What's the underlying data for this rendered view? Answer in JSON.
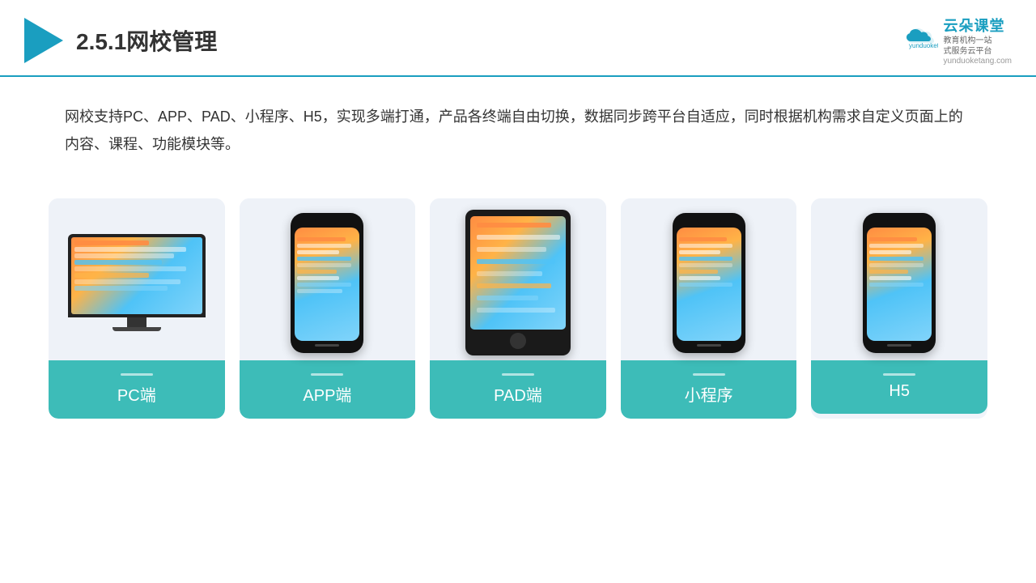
{
  "header": {
    "title": "2.5.1网校管理",
    "brand": {
      "name": "云朵课堂",
      "url": "yunduoketang.com",
      "slogan_line1": "教育机构一站",
      "slogan_line2": "式服务云平台"
    }
  },
  "description": {
    "text": "网校支持PC、APP、PAD、小程序、H5，实现多端打通，产品各终端自由切换，数据同步跨平台自适应，同时根据机构需求自定义页面上的内容、课程、功能模块等。"
  },
  "cards": [
    {
      "id": "pc",
      "label": "PC端",
      "type": "pc"
    },
    {
      "id": "app",
      "label": "APP端",
      "type": "phone"
    },
    {
      "id": "pad",
      "label": "PAD端",
      "type": "tablet"
    },
    {
      "id": "miniprogram",
      "label": "小程序",
      "type": "phone"
    },
    {
      "id": "h5",
      "label": "H5",
      "type": "phone"
    }
  ],
  "colors": {
    "accent": "#3dbcb8",
    "header_line": "#1a9ec0",
    "title": "#333333",
    "text": "#333333"
  }
}
